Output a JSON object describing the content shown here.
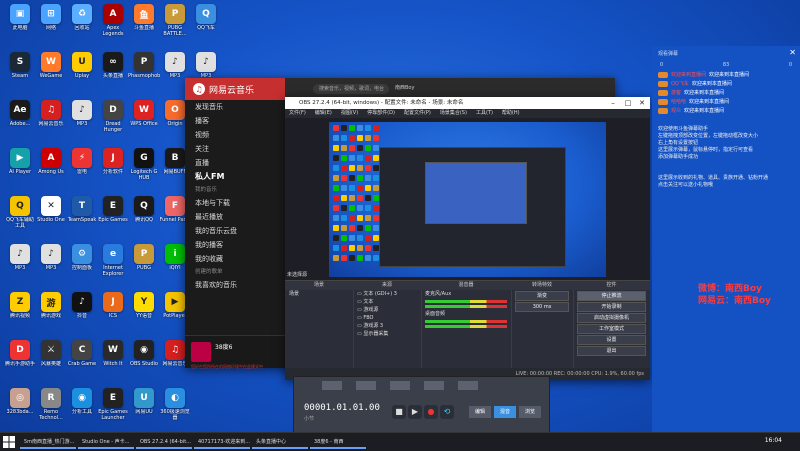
{
  "desktop_icons": [
    {
      "label": "此电脑",
      "color": "#4aa3ff",
      "glyph": "▣"
    },
    {
      "label": "Steam",
      "color": "#1b2838",
      "glyph": "S"
    },
    {
      "label": "Adobe...",
      "color": "#1a1a1a",
      "glyph": "Ae"
    },
    {
      "label": "AI Player",
      "color": "#16a1a8",
      "glyph": "▶"
    },
    {
      "label": "QQ飞车辅助工具",
      "color": "#f5c400",
      "glyph": "Q"
    },
    {
      "label": "MP3",
      "color": "#e0e0e0",
      "glyph": "♪"
    },
    {
      "label": "腾讯视频",
      "color": "#ffcc00",
      "glyph": "Z"
    },
    {
      "label": "腾讯手游助手",
      "color": "#e33",
      "glyph": "D"
    },
    {
      "label": "3283bda...",
      "color": "#c8a090",
      "glyph": "◎"
    },
    {
      "label": "网络",
      "color": "#4aa3ff",
      "glyph": "⊞"
    },
    {
      "label": "WeGame",
      "color": "#ff7a2b",
      "glyph": "W"
    },
    {
      "label": "网易云音乐",
      "color": "#d61f1f",
      "glyph": "♫"
    },
    {
      "label": "Among Us",
      "color": "#c00",
      "glyph": "A"
    },
    {
      "label": "Studio One",
      "color": "#fff",
      "glyph": "✕"
    },
    {
      "label": "MP3",
      "color": "#e0e0e0",
      "glyph": "♪"
    },
    {
      "label": "腾讯游戏",
      "color": "#ffcc00",
      "glyph": "游"
    },
    {
      "label": "风暴英雄",
      "color": "#333",
      "glyph": "⚔"
    },
    {
      "label": "Remo Technol...",
      "color": "#888",
      "glyph": "R"
    },
    {
      "label": "回收站",
      "color": "#5ab0ff",
      "glyph": "♻"
    },
    {
      "label": "Uplay",
      "color": "#ffcc00",
      "glyph": "U"
    },
    {
      "label": "MP3",
      "color": "#e0e0e0",
      "glyph": "♪"
    },
    {
      "label": "雷电",
      "color": "#e33",
      "glyph": "⚡"
    },
    {
      "label": "TeamSpeak",
      "color": "#1e5aa8",
      "glyph": "T"
    },
    {
      "label": "控制面板",
      "color": "#3a8fe0",
      "glyph": "⚙"
    },
    {
      "label": "抖音",
      "color": "#111",
      "glyph": "♪"
    },
    {
      "label": "Crab Game",
      "color": "#444",
      "glyph": "C"
    },
    {
      "label": "分析工具",
      "color": "#1b8fe0",
      "glyph": "◉"
    },
    {
      "label": "Apex Legends",
      "color": "#a00",
      "glyph": "A"
    },
    {
      "label": "头条直播",
      "color": "#1a1a1a",
      "glyph": "∞"
    },
    {
      "label": "Dread Hunger",
      "color": "#444",
      "glyph": "D"
    },
    {
      "label": "分析软件",
      "color": "#d22",
      "glyph": "J"
    },
    {
      "label": "Epic Games",
      "color": "#222",
      "glyph": "E"
    },
    {
      "label": "Internet Explorer",
      "color": "#2a7be0",
      "glyph": "e"
    },
    {
      "label": "ICS",
      "color": "#e96a1a",
      "glyph": "J"
    },
    {
      "label": "Witch It",
      "color": "#2a2a2a",
      "glyph": "W"
    },
    {
      "label": "Epic Games Launcher",
      "color": "#222",
      "glyph": "E"
    },
    {
      "label": "斗鱼直播",
      "color": "#ff7a2b",
      "glyph": "鱼"
    },
    {
      "label": "Phasmophobia",
      "color": "#333",
      "glyph": "P"
    },
    {
      "label": "WPS Office",
      "color": "#d22",
      "glyph": "W"
    },
    {
      "label": "Logitech G HUB",
      "color": "#111",
      "glyph": "G"
    },
    {
      "label": "腾讯QQ",
      "color": "#1a1a1a",
      "glyph": "Q"
    },
    {
      "label": "PUBG",
      "color": "#c99a3a",
      "glyph": "P"
    },
    {
      "label": "YY语音",
      "color": "#ffdd00",
      "glyph": "Y"
    },
    {
      "label": "OBS Studio",
      "color": "#222",
      "glyph": "◉"
    },
    {
      "label": "网易UU",
      "color": "#39c",
      "glyph": "U"
    },
    {
      "label": "PUBG BATTLE...",
      "color": "#c99a3a",
      "glyph": "P"
    },
    {
      "label": "MP3",
      "color": "#e0e0e0",
      "glyph": "♪"
    },
    {
      "label": "Origin",
      "color": "#f56c2d",
      "glyph": "O"
    },
    {
      "label": "网易BUFF",
      "color": "#1a1a1a",
      "glyph": "B"
    },
    {
      "label": "Funnel Party",
      "color": "#e66",
      "glyph": "F"
    },
    {
      "label": "iQIYI",
      "color": "#00be06",
      "glyph": "i"
    },
    {
      "label": "PotPlayer",
      "color": "#f5c400",
      "glyph": "▶"
    },
    {
      "label": "网易云音乐",
      "color": "#d61f1f",
      "glyph": "♫"
    },
    {
      "label": "360极速浏览器",
      "color": "#2a8fe0",
      "glyph": "◐"
    },
    {
      "label": "QQ飞车",
      "color": "#3a8fe0",
      "glyph": "Q"
    },
    {
      "label": "MP3",
      "color": "#e0e0e0",
      "glyph": "♪"
    },
    {
      "label": "PICO FMRX",
      "color": "#e0e0e0",
      "glyph": "◎"
    }
  ],
  "music_app": {
    "title": "网易云音乐",
    "search_placeholder": "搜索音乐，视频，歌词，电台",
    "user": "南西Boy",
    "nav": [
      {
        "label": "发现音乐",
        "active": false
      },
      {
        "label": "播客",
        "active": false
      },
      {
        "label": "视频",
        "active": false
      },
      {
        "label": "关注",
        "active": false
      },
      {
        "label": "直播",
        "active": false
      },
      {
        "label": "私人FM",
        "active": true
      }
    ],
    "section_my": "我的音乐",
    "my_items": [
      "本地与下载",
      "最近播放",
      "我的音乐云盘",
      "我的播客",
      "我的收藏"
    ],
    "section_created": "创建的歌单",
    "created_items": [
      "我喜欢的音乐"
    ],
    "song_title": "38度6",
    "song_sub": "您好在您所所在的网络环境中在此模式中"
  },
  "obs": {
    "title": "OBS 27.2.4 (64-bit, windows) - 配置文件: 未命名 - 场景: 未命名",
    "menu": [
      "文件(F)",
      "编辑(E)",
      "视图(V)",
      "停靠部件(D)",
      "配置文件(P)",
      "场景集合(S)",
      "工具(T)",
      "帮助(H)"
    ],
    "scene_header": "场景",
    "source_header": "来源",
    "mixer_header": "混音器",
    "transition_header": "转场特效",
    "controls_header": "控件",
    "scene_title": "未选择源",
    "scenes": [
      "场景"
    ],
    "sources": [
      "文本 (GDI+) 3",
      "文本",
      "游戏源",
      "FBO",
      "游戏源 3",
      "显示器采集"
    ],
    "mixer_tracks": [
      "麦克风/Aux",
      "桌面音频"
    ],
    "transition": "渐变",
    "transition_duration": "300 ms",
    "controls": [
      "停止推流",
      "开始录制",
      "启动虚拟摄像机",
      "工作室模式",
      "设置",
      "退出"
    ],
    "status": "LIVE: 00:00:00   REC: 00:00:00   CPU: 1.9%, 60.00 fps"
  },
  "studio_one": {
    "time": "00001.01.01.00",
    "time_sub": "小节",
    "tabs": [
      "编辑",
      "混音",
      "浏览"
    ],
    "active_tab": "混音"
  },
  "panel": {
    "header": "观看弹幕",
    "stats": [
      "0",
      "83",
      "0"
    ],
    "messages": [
      {
        "name": "欢迎来到直播间",
        "text": "欢迎来到本直播间"
      },
      {
        "name": "QQ飞车",
        "text": "欢迎来到本直播间"
      },
      {
        "name": "游客",
        "text": "欢迎来到本直播间"
      },
      {
        "name": "哈哈哈",
        "text": "欢迎来到本直播间"
      },
      {
        "name": "观众",
        "text": "欢迎来到本直播间"
      }
    ],
    "info_lines": [
      "欢迎使用斗鱼弹幕助手",
      "左键拖拽顶部改变位置，左键拖动框改变大小",
      "右上角有设置按钮",
      "这里展示弹幕，鼠标悬停时，指定行可查看",
      "添加弹幕助手成功"
    ],
    "info2_lines": [
      "这里展示收到的礼物、道具、贵族开通、钻粉开通",
      "点击关注可以送小礼物哦"
    ],
    "promo": [
      "微博：南西Boy",
      "网易云：南西Boy"
    ]
  },
  "taskbar": {
    "items": [
      "5m南西直播_热门游...",
      "Studio One - 声卡...",
      "OBS 27.2.4 (64-bit...",
      "40717173-欢迎来到...",
      "头条直播中心",
      "38度6 - 南西"
    ],
    "time": "16:04"
  }
}
